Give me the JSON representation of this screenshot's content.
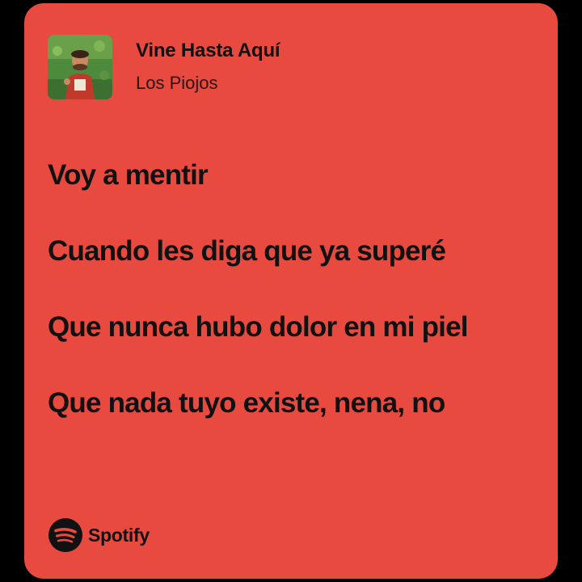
{
  "track": {
    "title": "Vine Hasta Aquí",
    "artist": "Los Piojos",
    "cover_icon": "album-cover"
  },
  "lyrics": [
    "Voy a mentir",
    "Cuando les diga que ya superé",
    "Que nunca hubo dolor en mi piel",
    "Que nada tuyo existe, nena, no"
  ],
  "brand": {
    "name": "Spotify",
    "icon": "spotify-logo-icon"
  },
  "colors": {
    "card_background": "#e84a40",
    "page_background": "#000000",
    "text": "#111111"
  }
}
